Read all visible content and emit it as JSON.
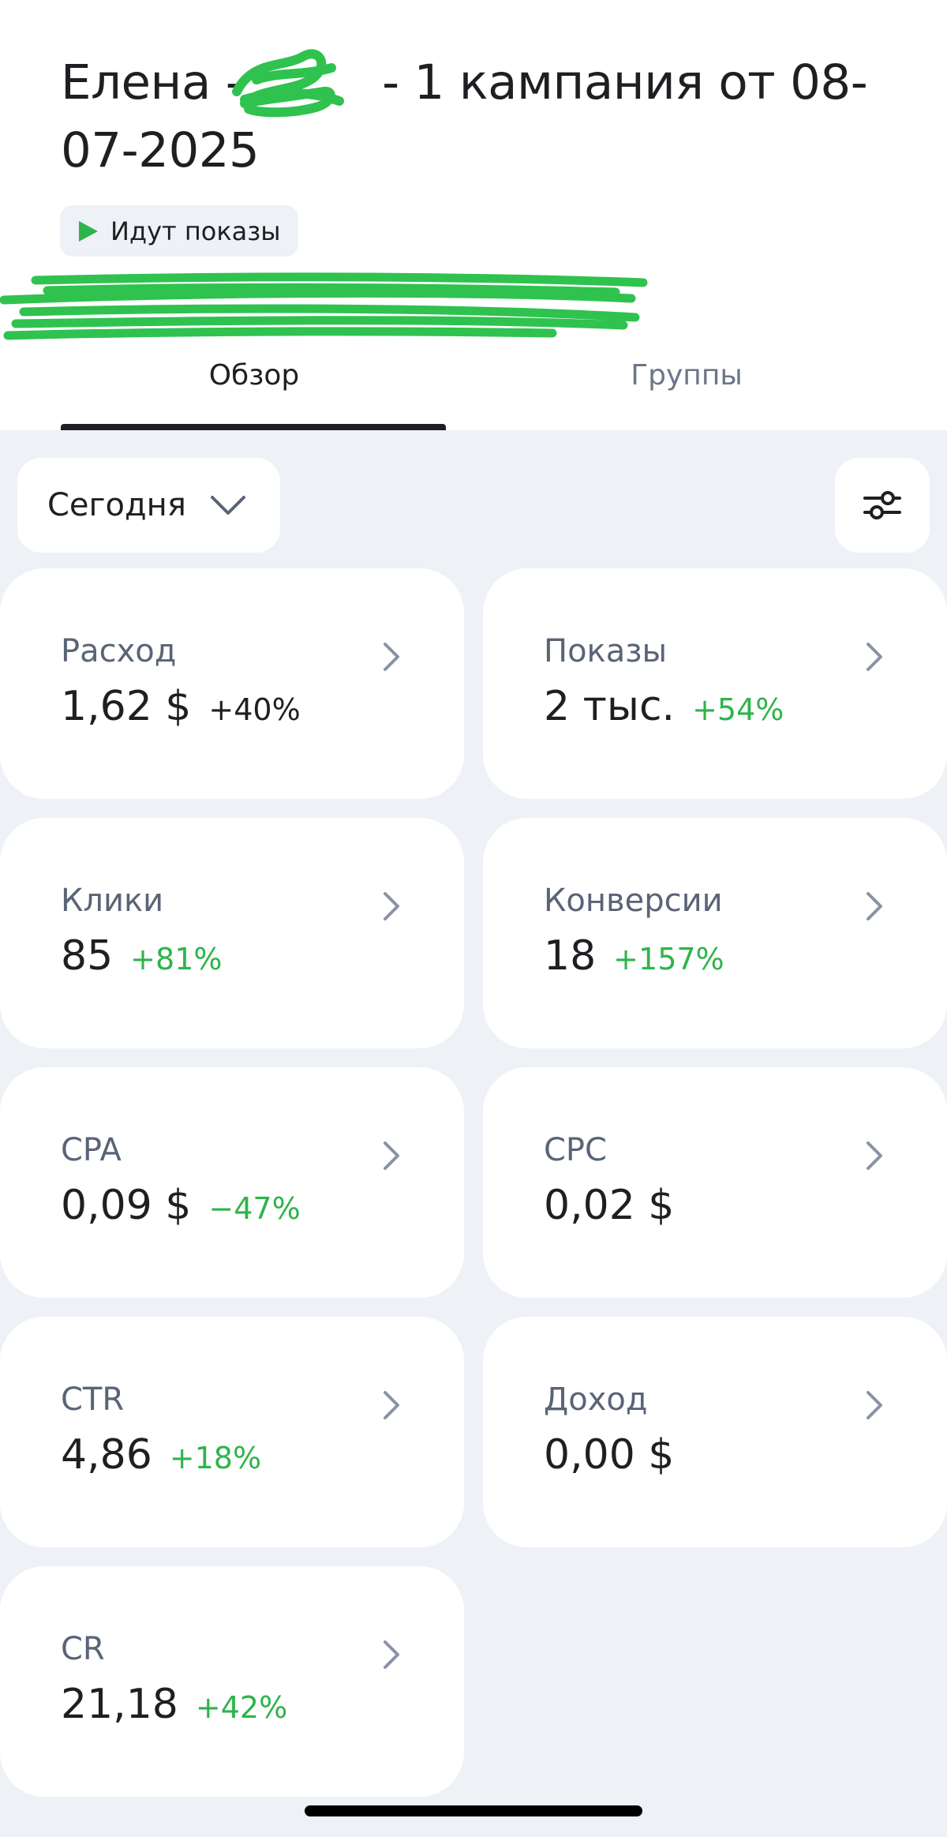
{
  "header": {
    "title_part1": "Елена -",
    "title_part2": " - 1 кампания от 08-07-2025",
    "status": "Идут показы"
  },
  "tabs": [
    {
      "label": "Обзор",
      "active": true
    },
    {
      "label": "Группы",
      "active": false
    }
  ],
  "toolbar": {
    "period_label": "Сегодня"
  },
  "metrics": [
    {
      "name": "Расход",
      "value": "1,62 $",
      "delta": "+40%",
      "delta_color": "#1f1f23"
    },
    {
      "name": "Показы",
      "value": "2 тыс.",
      "delta": "+54%",
      "delta_color": "#2eb44a"
    },
    {
      "name": "Клики",
      "value": "85",
      "delta": "+81%",
      "delta_color": "#2eb44a"
    },
    {
      "name": "Конверсии",
      "value": "18",
      "delta": "+157%",
      "delta_color": "#2eb44a"
    },
    {
      "name": "CPA",
      "value": "0,09 $",
      "delta": "−47%",
      "delta_color": "#2eb44a"
    },
    {
      "name": "CPC",
      "value": "0,02 $",
      "delta": "",
      "delta_color": "#2eb44a"
    },
    {
      "name": "CTR",
      "value": "4,86",
      "delta": "+18%",
      "delta_color": "#2eb44a"
    },
    {
      "name": "Доход",
      "value": "0,00 $",
      "delta": "",
      "delta_color": "#2eb44a"
    },
    {
      "name": "CR",
      "value": "21,18",
      "delta": "+42%",
      "delta_color": "#2eb44a"
    }
  ],
  "colors": {
    "accent_green": "#2eb44a",
    "redaction_green": "#2fc24f",
    "background": "#eef1f6",
    "text_primary": "#1f1f23",
    "text_secondary": "#5a6477"
  },
  "icons": {
    "status": "play-icon",
    "period": "chevron-down-icon",
    "filter": "filter-sliders-icon",
    "card": "chevron-right-icon"
  }
}
